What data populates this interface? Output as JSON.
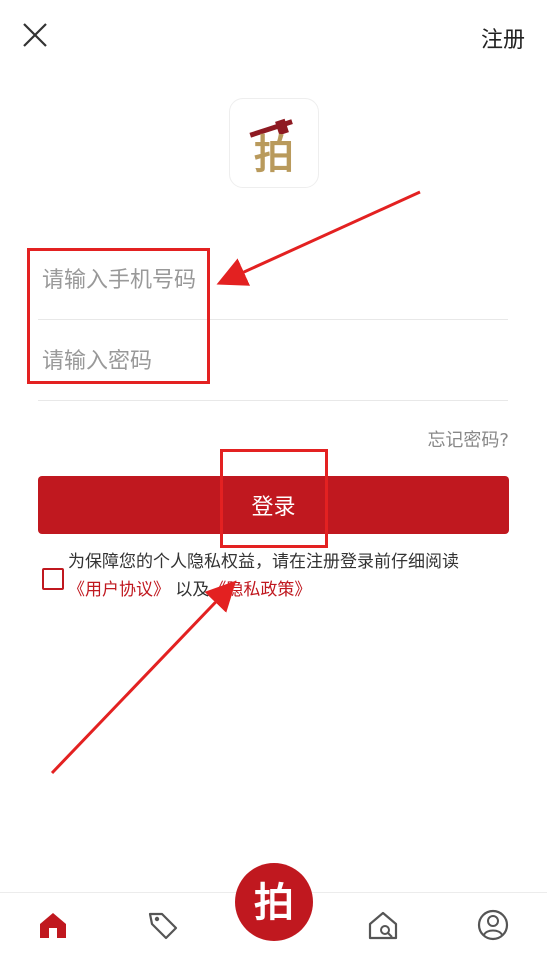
{
  "header": {
    "register_label": "注册"
  },
  "icons": {
    "close": "close-icon",
    "logo": "auction-logo",
    "home": "home-icon",
    "tag": "tag-icon",
    "auction": "auction-center-icon",
    "house_search": "house-search-icon",
    "profile": "profile-icon"
  },
  "logo_text": "拍",
  "form": {
    "phone_placeholder": "请输入手机号码",
    "phone_value": "",
    "password_placeholder": "请输入密码",
    "password_value": "",
    "forgot_label": "忘记密码?",
    "login_label": "登录"
  },
  "agreement": {
    "checked": false,
    "text_prefix": "为保障您的个人隐私权益，请在注册登录前仔细阅读",
    "user_agreement": "《用户协议》",
    "conjunction": "以及",
    "privacy_policy": "《隐私政策》"
  },
  "tabbar": {
    "active": "home",
    "center_text": "拍"
  },
  "colors": {
    "brand_red": "#c0181f",
    "annotation_red": "#e32121",
    "logo_gold": "#b99a5c"
  }
}
